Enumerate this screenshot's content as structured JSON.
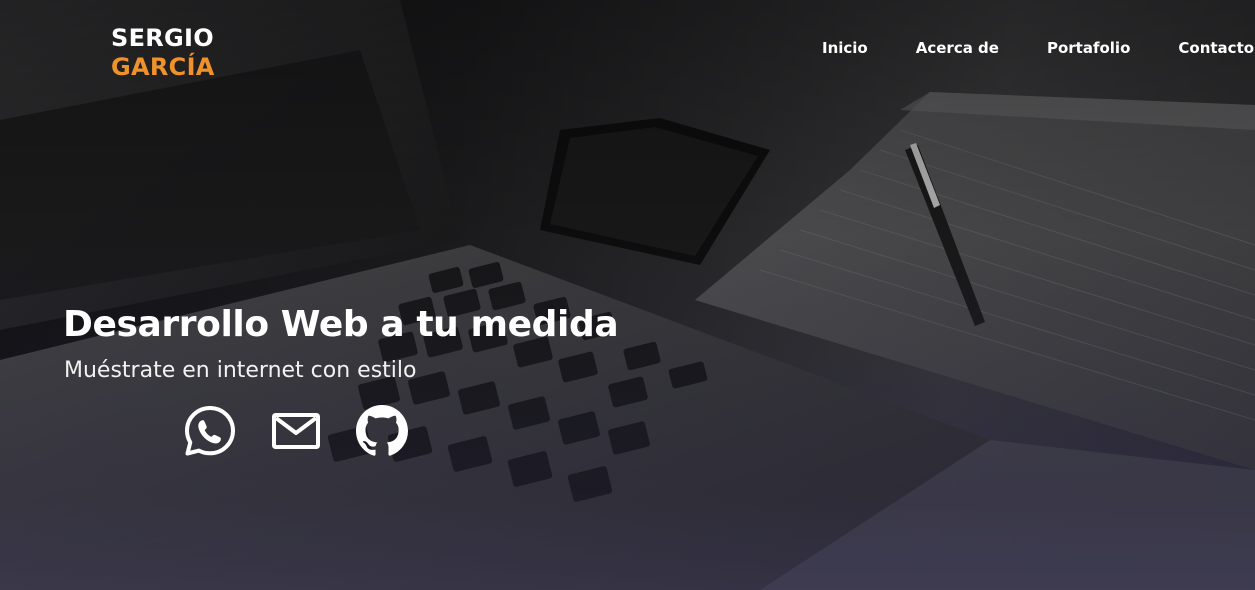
{
  "brand": {
    "line1": "SERGIO",
    "line2": "GARCÍA",
    "accent_color": "#f0922b"
  },
  "nav": {
    "items": [
      {
        "label": "Inicio"
      },
      {
        "label": "Acerca de"
      },
      {
        "label": "Portafolio"
      },
      {
        "label": "Contacto"
      }
    ]
  },
  "hero": {
    "headline": "Desarrollo Web a tu medida",
    "subheadline": "Muéstrate en internet con estilo",
    "background": "dark photo of laptop keyboard, smartphone and notebook with pen"
  },
  "social": {
    "icons": [
      {
        "name": "whatsapp-icon"
      },
      {
        "name": "mail-icon"
      },
      {
        "name": "github-icon"
      }
    ],
    "icon_color": "#ffffff"
  }
}
